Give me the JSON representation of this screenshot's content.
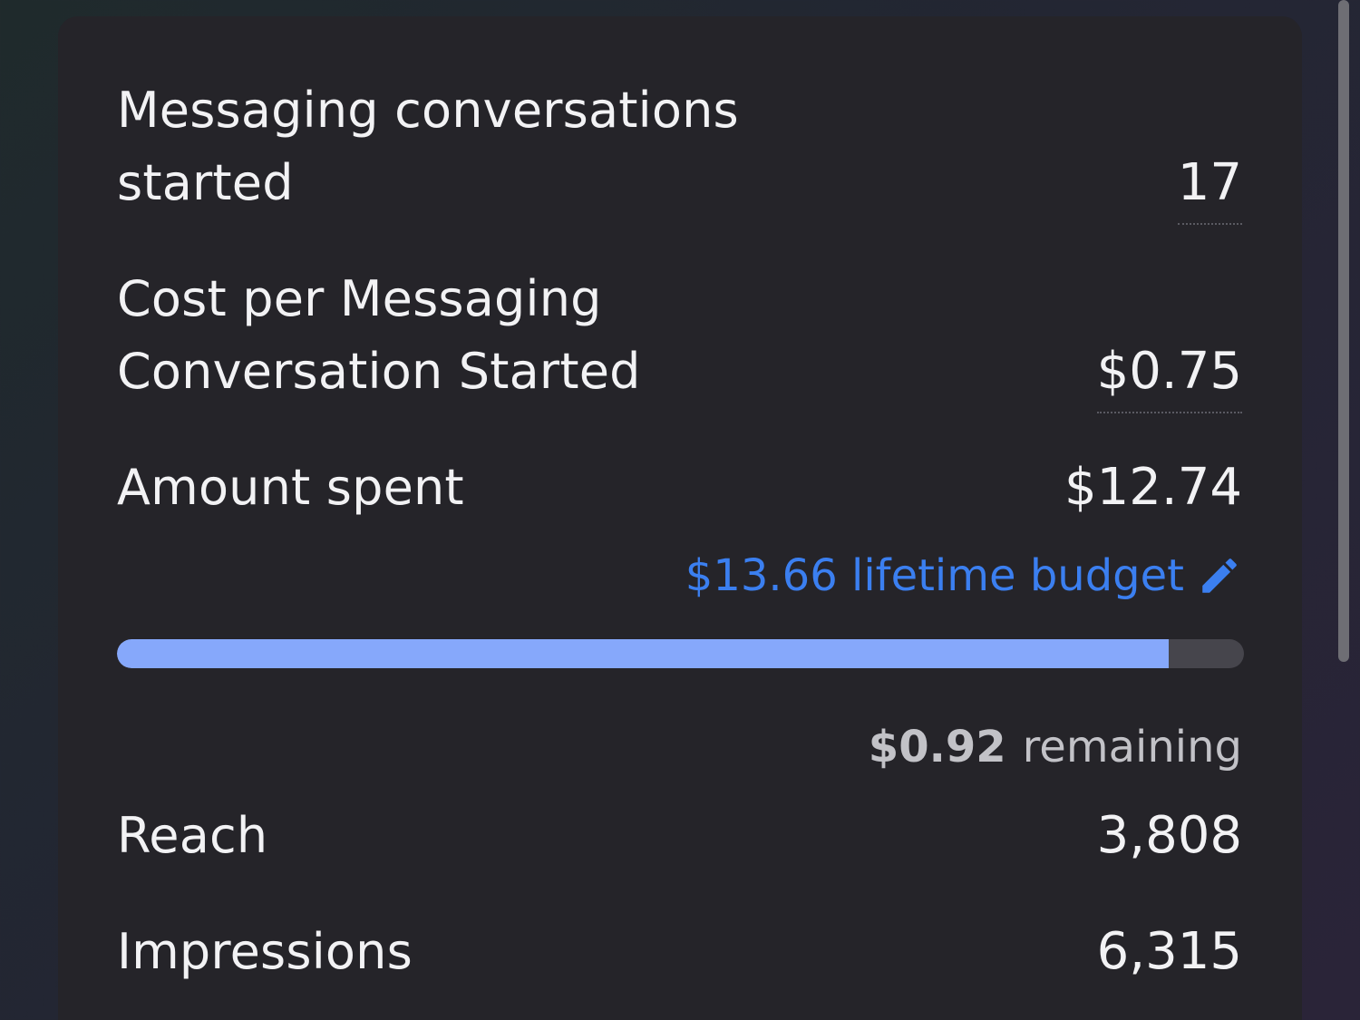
{
  "metrics": {
    "conversations": {
      "label": "Messaging conversations\nstarted",
      "value": "17"
    },
    "cost_per": {
      "label": "Cost per Messaging\nConversation Started",
      "value": "$0.75"
    },
    "amount_spent": {
      "label": "Amount spent",
      "value": "$12.74"
    },
    "reach": {
      "label": "Reach",
      "value": "3,808"
    },
    "impressions": {
      "label": "Impressions",
      "value": "6,315"
    }
  },
  "budget": {
    "link_text": "$13.66 lifetime budget",
    "edit_icon": "pencil-icon",
    "spent_fraction": 0.933,
    "remaining_amount": "$0.92",
    "remaining_label": "remaining"
  },
  "colors": {
    "card": "#252429",
    "accent_link": "#3b7ff0",
    "progress_fill": "#86a8fb",
    "progress_track": "#46454c"
  }
}
